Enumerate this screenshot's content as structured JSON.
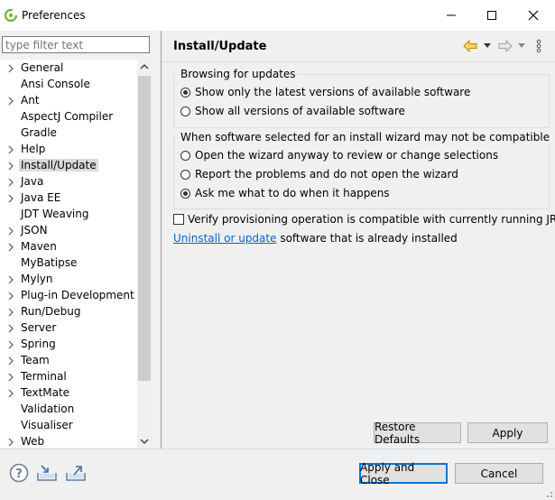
{
  "window": {
    "title": "Preferences",
    "minimize_glyph": "—",
    "maximize_glyph": "☐",
    "close_glyph": "✕"
  },
  "filter": {
    "placeholder": "type filter text"
  },
  "tree": {
    "items": [
      {
        "label": "General",
        "expandable": true,
        "selected": false
      },
      {
        "label": "Ansi Console",
        "expandable": false,
        "selected": false
      },
      {
        "label": "Ant",
        "expandable": true,
        "selected": false
      },
      {
        "label": "AspectJ Compiler",
        "expandable": false,
        "selected": false
      },
      {
        "label": "Gradle",
        "expandable": false,
        "selected": false
      },
      {
        "label": "Help",
        "expandable": true,
        "selected": false
      },
      {
        "label": "Install/Update",
        "expandable": true,
        "selected": true
      },
      {
        "label": "Java",
        "expandable": true,
        "selected": false
      },
      {
        "label": "Java EE",
        "expandable": true,
        "selected": false
      },
      {
        "label": "JDT Weaving",
        "expandable": false,
        "selected": false
      },
      {
        "label": "JSON",
        "expandable": true,
        "selected": false
      },
      {
        "label": "Maven",
        "expandable": true,
        "selected": false
      },
      {
        "label": "MyBatipse",
        "expandable": false,
        "selected": false
      },
      {
        "label": "Mylyn",
        "expandable": true,
        "selected": false
      },
      {
        "label": "Plug-in Development",
        "expandable": true,
        "selected": false
      },
      {
        "label": "Run/Debug",
        "expandable": true,
        "selected": false
      },
      {
        "label": "Server",
        "expandable": true,
        "selected": false
      },
      {
        "label": "Spring",
        "expandable": true,
        "selected": false
      },
      {
        "label": "Team",
        "expandable": true,
        "selected": false
      },
      {
        "label": "Terminal",
        "expandable": true,
        "selected": false
      },
      {
        "label": "TextMate",
        "expandable": true,
        "selected": false
      },
      {
        "label": "Validation",
        "expandable": false,
        "selected": false
      },
      {
        "label": "Visualiser",
        "expandable": false,
        "selected": false
      },
      {
        "label": "Web",
        "expandable": true,
        "selected": false
      }
    ]
  },
  "page": {
    "title": "Install/Update",
    "browsing_group": {
      "title": "Browsing for updates",
      "options": [
        {
          "label": "Show only the latest versions of available software",
          "checked": true
        },
        {
          "label": "Show all versions of available software",
          "checked": false
        }
      ]
    },
    "compat_group": {
      "title": "When software selected for an install wizard may not be compatible",
      "options": [
        {
          "label": "Open the wizard anyway to review or change selections",
          "checked": false
        },
        {
          "label": "Report the problems and do not open the wizard",
          "checked": false
        },
        {
          "label": "Ask me what to do when it happens",
          "checked": true
        }
      ]
    },
    "verify_label": "Verify provisioning operation is compatible with currently running JRE",
    "uninstall_link": "Uninstall or update",
    "uninstall_rest": " software that is already installed",
    "restore_defaults": "Restore Defaults",
    "apply": "Apply"
  },
  "footer": {
    "apply_and_close": "Apply and Close",
    "cancel": "Cancel"
  },
  "colors": {
    "accent": "#0078d7",
    "link": "#0066cc",
    "spring_green": "#6db33f"
  }
}
